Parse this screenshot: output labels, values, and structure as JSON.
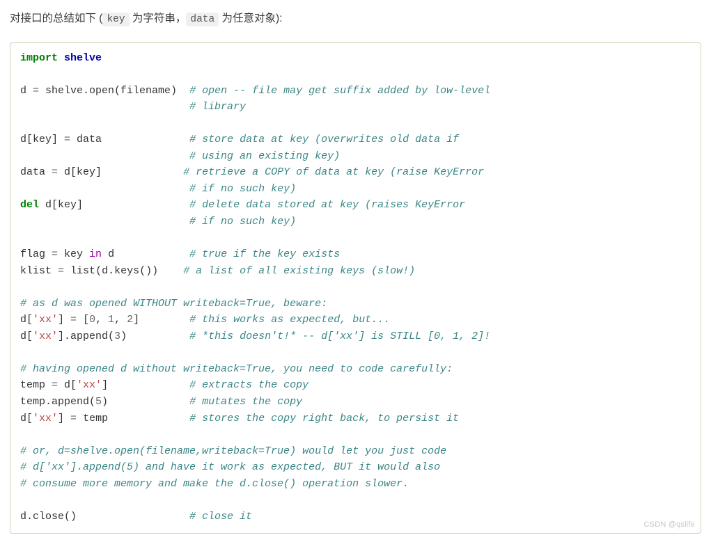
{
  "intro": {
    "prefix": "对接口的总结如下 (",
    "key_code": "key",
    "mid1": " 为字符串，",
    "data_code": "data",
    "suffix": " 为任意对象):"
  },
  "code": {
    "l01_kw_import": "import",
    "l01_mod": " shelve",
    "l03_lhs": "d ",
    "l03_op": "=",
    "l03_rhs": " shelve.open(filename)  ",
    "l03_cmt": "# open -- file may get suffix added by low-level",
    "l04_pad": "                           ",
    "l04_cmt": "# library",
    "l06_text": "d[key] ",
    "l06_op": "=",
    "l06_text2": " data              ",
    "l06_cmt": "# store data at key (overwrites old data if",
    "l07_pad": "                           ",
    "l07_cmt": "# using an existing key)",
    "l08_text": "data ",
    "l08_op": "=",
    "l08_text2": " d[key]             ",
    "l08_cmt": "# retrieve a COPY of data at key (raise KeyError",
    "l09_pad": "                           ",
    "l09_cmt": "# if no such key)",
    "l10_kw_del": "del",
    "l10_text": " d[key]                 ",
    "l10_cmt": "# delete data stored at key (raises KeyError",
    "l11_pad": "                           ",
    "l11_cmt": "# if no such key)",
    "l13_text": "flag ",
    "l13_op": "=",
    "l13_text2": " key ",
    "l13_kw_in": "in",
    "l13_text3": " d            ",
    "l13_cmt": "# true if the key exists",
    "l14_text": "klist ",
    "l14_op": "=",
    "l14_text2": " ",
    "l14_fn": "list",
    "l14_text3": "(d.keys())    ",
    "l14_cmt": "# a list of all existing keys (slow!)",
    "l16_cmt": "# as d was opened WITHOUT writeback=True, beware:",
    "l17_text": "d[",
    "l17_str": "'xx'",
    "l17_text2": "] ",
    "l17_op": "=",
    "l17_text3": " [",
    "l17_n0": "0",
    "l17_sep1": ", ",
    "l17_n1": "1",
    "l17_sep2": ", ",
    "l17_n2": "2",
    "l17_text4": "]        ",
    "l17_cmt": "# this works as expected, but...",
    "l18_text": "d[",
    "l18_str": "'xx'",
    "l18_text2": "].append(",
    "l18_n3": "3",
    "l18_text3": ")          ",
    "l18_cmt": "# *this doesn't!* -- d['xx'] is STILL [0, 1, 2]!",
    "l20_cmt": "# having opened d without writeback=True, you need to code carefully:",
    "l21_text": "temp ",
    "l21_op": "=",
    "l21_text2": " d[",
    "l21_str": "'xx'",
    "l21_text3": "]             ",
    "l21_cmt": "# extracts the copy",
    "l22_text": "temp.append(",
    "l22_n5": "5",
    "l22_text2": ")             ",
    "l22_cmt": "# mutates the copy",
    "l23_text": "d[",
    "l23_str": "'xx'",
    "l23_text2": "] ",
    "l23_op": "=",
    "l23_text3": " temp             ",
    "l23_cmt": "# stores the copy right back, to persist it",
    "l25_cmt": "# or, d=shelve.open(filename,writeback=True) would let you just code",
    "l26_cmt": "# d['xx'].append(5) and have it work as expected, BUT it would also",
    "l27_cmt": "# consume more memory and make the d.close() operation slower.",
    "l29_text": "d.close()                  ",
    "l29_cmt": "# close it"
  },
  "watermark": "CSDN @qslife"
}
